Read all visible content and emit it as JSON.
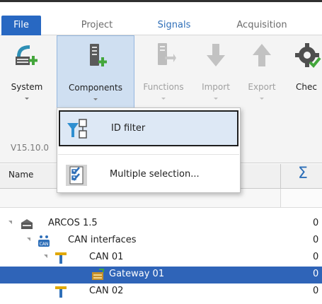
{
  "menu": {
    "tabs": [
      {
        "label": "File"
      },
      {
        "label": "Project"
      },
      {
        "label": "Signals"
      },
      {
        "label": "Acquisition"
      }
    ]
  },
  "ribbon": {
    "buttons": [
      {
        "label": "System",
        "icon": "system-add-icon",
        "enabled": true
      },
      {
        "label": "Components",
        "icon": "components-add-icon",
        "enabled": true,
        "active": true
      },
      {
        "label": "Functions",
        "icon": "functions-icon",
        "enabled": false
      },
      {
        "label": "Import",
        "icon": "import-arrow-icon",
        "enabled": false
      },
      {
        "label": "Export",
        "icon": "export-arrow-icon",
        "enabled": false
      },
      {
        "label": "Chec",
        "icon": "check-gear-icon",
        "enabled": true
      }
    ]
  },
  "dropdown": {
    "items": [
      {
        "label": "ID filter",
        "icon": "id-filter-icon",
        "highlighted": true
      },
      {
        "label": "Multiple selection...",
        "icon": "multiple-selection-icon"
      }
    ]
  },
  "panel": {
    "version": "V15.10.0"
  },
  "grid": {
    "columns": {
      "name": "Name",
      "sum": "Σ"
    },
    "rows": [
      {
        "label": "ARCOS 1.5",
        "value": "0",
        "icon": "device-icon",
        "level": 0
      },
      {
        "label": "CAN interfaces",
        "value": "0",
        "icon": "can-icon",
        "level": 1
      },
      {
        "label": "CAN 01",
        "value": "0",
        "icon": "can-bus-icon",
        "level": 2
      },
      {
        "label": "Gateway 01",
        "value": "0",
        "icon": "gateway-icon",
        "level": 3,
        "selected": true
      },
      {
        "label": "CAN 02",
        "value": "0",
        "icon": "can-bus-icon",
        "level": 2
      }
    ]
  },
  "colors": {
    "accent": "#2868c2",
    "selected_row": "#2f64b8",
    "ribbon_active": "#cfdff1"
  }
}
